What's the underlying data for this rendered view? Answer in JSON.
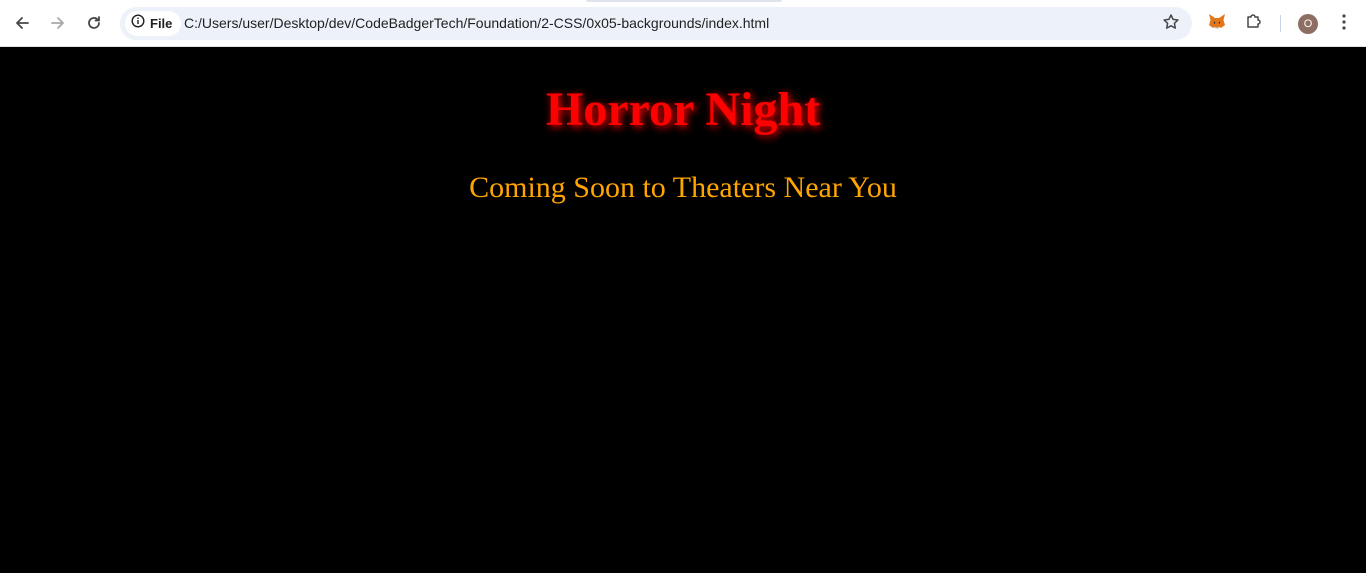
{
  "browser": {
    "address_bar": {
      "scheme_chip_label": "File",
      "url": "C:/Users/user/Desktop/dev/CodeBadgerTech/Foundation/2-CSS/0x05-backgrounds/index.html"
    },
    "profile_initial": "O",
    "icons": {
      "back": "arrow-left-icon",
      "forward": "arrow-right-icon",
      "reload": "reload-icon",
      "site_info": "info-icon",
      "bookmark": "star-icon",
      "extension_metamask": "fox-icon",
      "extensions": "puzzle-icon",
      "menu": "kebab-menu-icon"
    }
  },
  "page": {
    "title": "Horror Night",
    "subtitle": "Coming Soon to Theaters Near You"
  },
  "colors": {
    "page_background": "#000000",
    "title": "#ff0000",
    "subtitle": "#ffa500"
  }
}
